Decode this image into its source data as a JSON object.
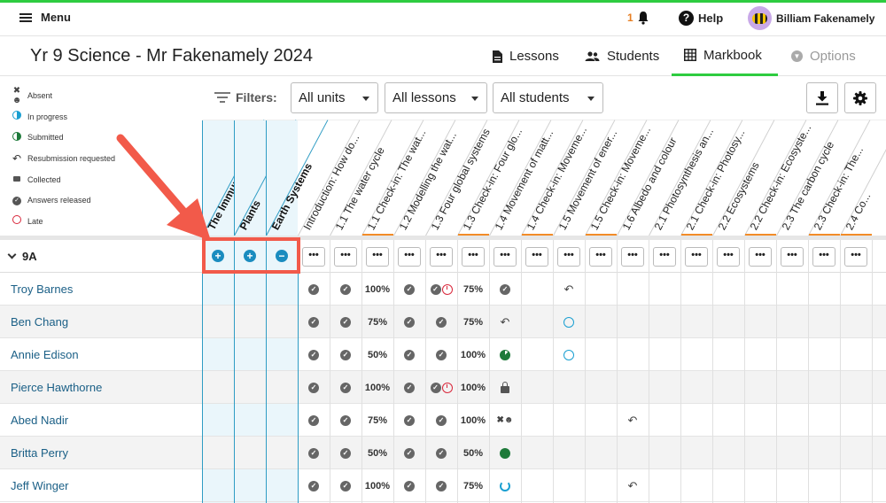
{
  "topbar": {
    "menu_label": "Menu",
    "notif_count": "1",
    "help_label": "Help",
    "user_name": "Billiam Fakenamely"
  },
  "page": {
    "title": "Yr 9 Science - Mr Fakenamely 2024"
  },
  "nav_tabs": [
    {
      "label": "Lessons",
      "icon": "document-icon"
    },
    {
      "label": "Students",
      "icon": "people-icon"
    },
    {
      "label": "Markbook",
      "icon": "grid-icon",
      "active": true
    },
    {
      "label": "Options",
      "icon": "chevron-circle-icon",
      "disabled": true
    }
  ],
  "legend": [
    {
      "label": "Absent",
      "icon": "absent-icon"
    },
    {
      "label": "In progress",
      "icon": "in-progress-icon"
    },
    {
      "label": "Submitted",
      "icon": "submitted-icon"
    },
    {
      "label": "Resubmission requested",
      "icon": "resubmission-icon"
    },
    {
      "label": "Collected",
      "icon": "collected-icon"
    },
    {
      "label": "Answers released",
      "icon": "answers-released-icon"
    },
    {
      "label": "Late",
      "icon": "late-icon"
    }
  ],
  "filters": {
    "label": "Filters:",
    "units": "All units",
    "lessons": "All lessons",
    "students": "All students"
  },
  "colors": {
    "accent": "#2ecc40",
    "unit_blue": "#2e9cc4",
    "orange": "#f28c28",
    "annotation": "#f25a4a"
  },
  "columns": [
    {
      "label": "The Immune System",
      "unit": true,
      "group_action": "+"
    },
    {
      "label": "Plants",
      "unit": true,
      "group_action": "+"
    },
    {
      "label": "Earth Systems",
      "unit": true,
      "group_action": "−"
    },
    {
      "label": "Introduction: How do..."
    },
    {
      "label": "1.1 The water cycle"
    },
    {
      "label": "1.1 Check-in: The wat...",
      "orange": true
    },
    {
      "label": "1.2 Modelling the wat..."
    },
    {
      "label": "1.3 Four global systems"
    },
    {
      "label": "1.3 Check-in: Four glo...",
      "orange": true
    },
    {
      "label": "1.4 Movement of matt..."
    },
    {
      "label": "1.4 Check-in: Moveme...",
      "orange": true
    },
    {
      "label": "1.5 Movement of ener..."
    },
    {
      "label": "1.5 Check-in: Moveme...",
      "orange": true
    },
    {
      "label": "1.6 Albedo and colour"
    },
    {
      "label": "2.1 Photosynthesis an..."
    },
    {
      "label": "2.1 Check-in: Photosy...",
      "orange": true
    },
    {
      "label": "2.2 Ecosystems"
    },
    {
      "label": "2.2 Check-in: Ecosyste...",
      "orange": true
    },
    {
      "label": "2.3 The carbon cycle"
    },
    {
      "label": "2.3 Check-in: The...",
      "orange": true
    },
    {
      "label": "2.4 Co...",
      "orange": true
    }
  ],
  "group": {
    "name": "9A",
    "dots_label": "•••"
  },
  "students": [
    {
      "name": "Troy Barnes",
      "cells": [
        "chk",
        "chk",
        "100%",
        "chk",
        "chklate",
        "75%",
        "chk",
        "",
        "resub"
      ]
    },
    {
      "name": "Ben Chang",
      "cells": [
        "chk",
        "chk",
        "75%",
        "chk",
        "chk",
        "75%",
        "resub",
        "",
        "inprog"
      ]
    },
    {
      "name": "Annie Edison",
      "cells": [
        "chk",
        "chk",
        "50%",
        "chk",
        "chk",
        "100%",
        "subpart",
        "",
        "inprog"
      ]
    },
    {
      "name": "Pierce Hawthorne",
      "cells": [
        "chk",
        "chk",
        "100%",
        "chk",
        "chklate",
        "100%",
        "lock",
        "",
        ""
      ]
    },
    {
      "name": "Abed Nadir",
      "cells": [
        "chk",
        "chk",
        "75%",
        "chk",
        "chk",
        "100%",
        "absent",
        "",
        "",
        "",
        "resub"
      ]
    },
    {
      "name": "Britta Perry",
      "cells": [
        "chk",
        "chk",
        "50%",
        "chk",
        "chk",
        "50%",
        "subfull",
        "",
        ""
      ]
    },
    {
      "name": "Jeff Winger",
      "cells": [
        "chk",
        "chk",
        "100%",
        "chk",
        "chk",
        "75%",
        "inprogpart",
        "",
        "",
        "",
        "resub"
      ]
    }
  ]
}
